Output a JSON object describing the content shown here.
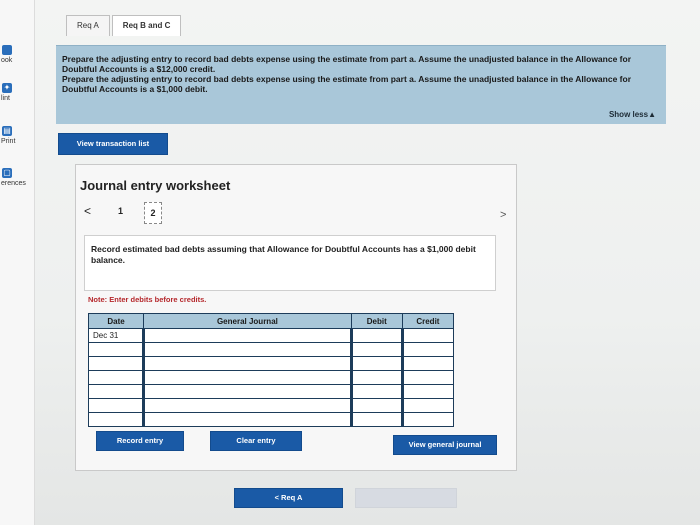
{
  "tabs": [
    {
      "label": "Req A"
    },
    {
      "label": "Req B and C"
    }
  ],
  "rail": {
    "items": [
      {
        "label": "ook"
      },
      {
        "label": "lint"
      },
      {
        "label": "Print"
      },
      {
        "label": "erences"
      }
    ]
  },
  "instructions": {
    "line1": "Prepare the adjusting entry to record bad debts expense using the estimate from part a. Assume the unadjusted balance in the Allowance for Doubtful Accounts is a $12,000 credit.",
    "line2": "Prepare the adjusting entry to record bad debts expense using the estimate from part a. Assume the unadjusted balance in the Allowance for Doubtful Accounts is a $1,000 debit.",
    "show_less": "Show less▲"
  },
  "view_transaction_list": "View transaction list",
  "worksheet": {
    "title": "Journal entry worksheet",
    "prev": "<",
    "page1": "1",
    "page2": "2",
    "next": ">",
    "description": "Record estimated bad debts assuming that Allowance for Doubtful Accounts has a $1,000 debit balance.",
    "note": "Note: Enter debits before credits.",
    "columns": {
      "date": "Date",
      "general_journal": "General Journal",
      "debit": "Debit",
      "credit": "Credit"
    },
    "rows": [
      {
        "date": "Dec 31"
      },
      {
        "date": ""
      },
      {
        "date": ""
      },
      {
        "date": ""
      },
      {
        "date": ""
      },
      {
        "date": ""
      },
      {
        "date": ""
      }
    ],
    "record_entry": "Record entry",
    "clear_entry": "Clear entry",
    "view_general_journal": "View general journal"
  },
  "footer": {
    "req_a": "<  Req A"
  }
}
